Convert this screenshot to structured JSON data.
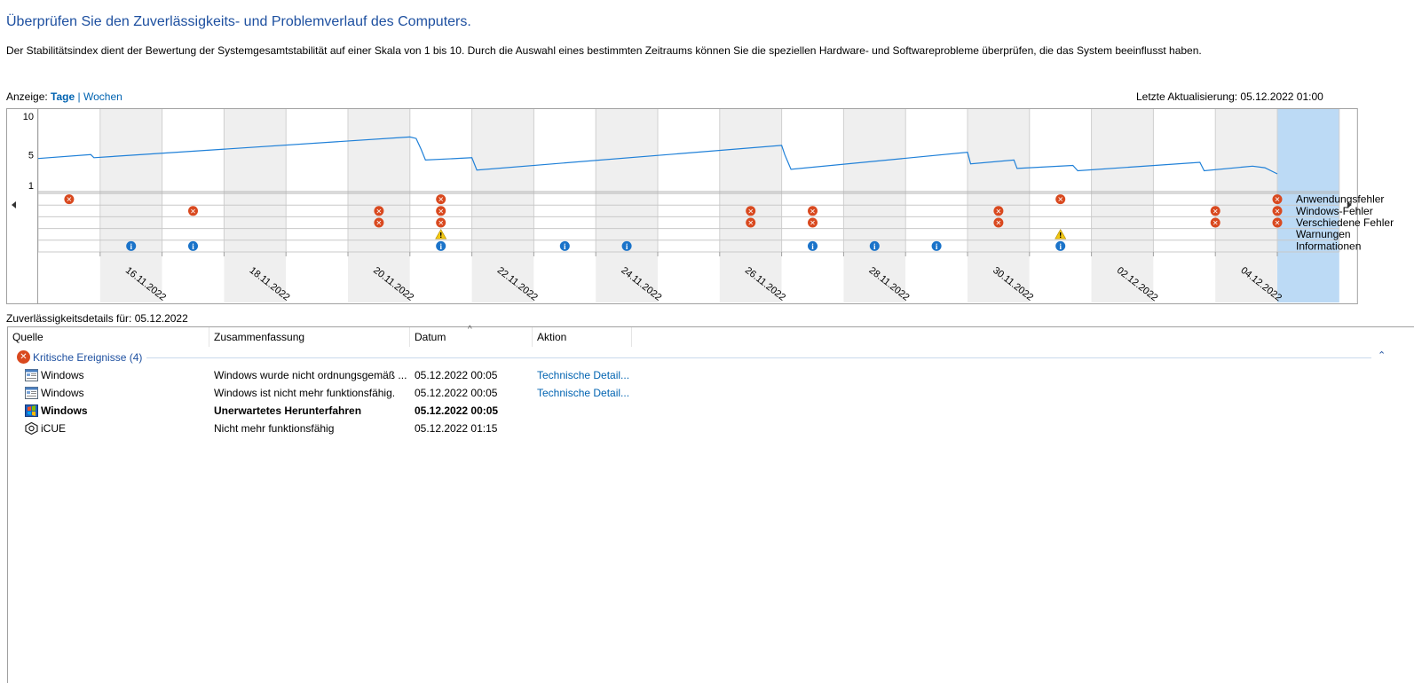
{
  "page": {
    "title": "Überprüfen Sie den Zuverlässigkeits- und Problemverlauf des Computers.",
    "description": "Der Stabilitätsindex dient der Bewertung der Systemgesamtstabilität auf einer Skala von 1 bis 10. Durch die Auswahl eines bestimmten Zeitraums können Sie die speziellen Hardware- und Softwareprobleme überprüfen, die das System beeinflusst haben.",
    "view_label": "Anzeige:",
    "view_days": "Tage",
    "view_separator": "|",
    "view_weeks": "Wochen",
    "last_update": "Letzte Aktualisierung: 05.12.2022 01:00",
    "details_label": "Zuverlässigkeitsdetails für: 05.12.2022"
  },
  "chart_data": {
    "type": "line",
    "y_ticks": [
      "10",
      "5",
      "1"
    ],
    "ylim": [
      1,
      10
    ],
    "dates": [
      "15.11.2022",
      "16.11.2022",
      "17.11.2022",
      "18.11.2022",
      "19.11.2022",
      "20.11.2022",
      "21.11.2022",
      "22.11.2022",
      "23.11.2022",
      "24.11.2022",
      "25.11.2022",
      "26.11.2022",
      "27.11.2022",
      "28.11.2022",
      "29.11.2022",
      "30.11.2022",
      "01.12.2022",
      "02.12.2022",
      "03.12.2022",
      "04.12.2022",
      "05.12.2022"
    ],
    "x_tick_labels": [
      "16.11.2022",
      "18.11.2022",
      "20.11.2022",
      "22.11.2022",
      "24.11.2022",
      "26.11.2022",
      "28.11.2022",
      "30.11.2022",
      "02.12.2022",
      "04.12.2022"
    ],
    "selected_date": "05.12.2022",
    "stability_index": [
      [
        0.0,
        4.5
      ],
      [
        0.85,
        5.0
      ],
      [
        0.9,
        4.6
      ],
      [
        6.0,
        7.3
      ],
      [
        6.1,
        7.1
      ],
      [
        6.18,
        5.7
      ],
      [
        6.25,
        4.3
      ],
      [
        7.0,
        4.6
      ],
      [
        7.08,
        3.0
      ],
      [
        12.0,
        6.2
      ],
      [
        12.05,
        5.0
      ],
      [
        12.15,
        3.1
      ],
      [
        15.0,
        5.3
      ],
      [
        15.05,
        3.8
      ],
      [
        15.75,
        4.3
      ],
      [
        15.8,
        3.2
      ],
      [
        16.7,
        3.6
      ],
      [
        16.78,
        2.9
      ],
      [
        18.75,
        4.0
      ],
      [
        18.82,
        2.9
      ],
      [
        19.6,
        3.5
      ],
      [
        19.8,
        3.3
      ],
      [
        20.0,
        2.5
      ]
    ],
    "event_rows": [
      "Anwendungsfehler",
      "Windows-Fehler",
      "Verschiedene Fehler",
      "Warnungen",
      "Informationen"
    ],
    "events": {
      "Anwendungsfehler": [
        0,
        6,
        16,
        19.5
      ],
      "Windows-Fehler": [
        2,
        5,
        6,
        11,
        12,
        15,
        18.5,
        19.5
      ],
      "Verschiedene Fehler": [
        5,
        6,
        11,
        12,
        15,
        18.5,
        19.5
      ],
      "Warnungen": [
        6,
        16
      ],
      "Informationen": [
        1,
        2,
        6,
        8,
        9,
        12,
        13,
        14,
        16
      ]
    }
  },
  "table": {
    "columns": [
      "Quelle",
      "Zusammenfassung",
      "Datum",
      "Aktion"
    ],
    "group": {
      "label": "Kritische Ereignisse (4)",
      "collapse_glyph": "⌃"
    },
    "rows": [
      {
        "source": "Windows",
        "summary": "Windows wurde nicht ordnungsgemäß ...",
        "date": "05.12.2022 00:05",
        "action": "Technische Detail...",
        "icon": "window-app-icon",
        "bold": false
      },
      {
        "source": "Windows",
        "summary": "Windows ist nicht mehr funktionsfähig.",
        "date": "05.12.2022 00:05",
        "action": "Technische Detail...",
        "icon": "window-app-icon",
        "bold": false
      },
      {
        "source": "Windows",
        "summary": "Unerwartetes Herunterfahren",
        "date": "05.12.2022 00:05",
        "action": "",
        "icon": "windows-shield-icon",
        "bold": true
      },
      {
        "source": "iCUE",
        "summary": "Nicht mehr funktionsfähig",
        "date": "05.12.2022 01:15",
        "action": "",
        "icon": "icue-icon",
        "bold": false
      }
    ]
  },
  "colors": {
    "accent_blue": "#0063b1",
    "title_blue": "#1e50a0",
    "error_red": "#d9491f",
    "info_blue": "#1a73c9",
    "warning_yellow": "#f2c811",
    "stability_line": "#1f80d8",
    "selected_column": "#bcdaf5",
    "alt_column": "#efefef"
  }
}
